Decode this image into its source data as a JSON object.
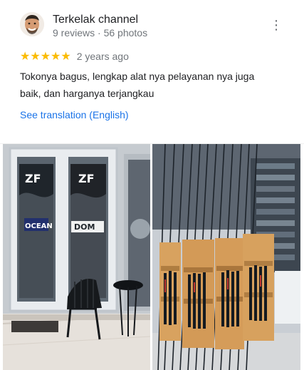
{
  "review": {
    "author": "Terkelak channel",
    "author_meta": "9 reviews · 56 photos",
    "rating": 5,
    "rating_stars": "★★★★★",
    "time_ago": "2 years ago",
    "text": "Tokonya bagus, lengkap alat nya pelayanan nya juga baik, dan harganya terjangkau",
    "translation_link": "See translation (English)",
    "more_icon": "more-vert-icon"
  },
  "photos": [
    {
      "kind": "store-entrance",
      "signage": {
        "brand_1": "ZF",
        "brand_2": "OCEAN",
        "brand_3": "DOM"
      }
    },
    {
      "kind": "fishing-rod-racks"
    }
  ],
  "colors": {
    "link": "#1a73e8",
    "stars": "#fbbc04",
    "secondary_text": "#70757a",
    "primary_text": "#202124"
  }
}
